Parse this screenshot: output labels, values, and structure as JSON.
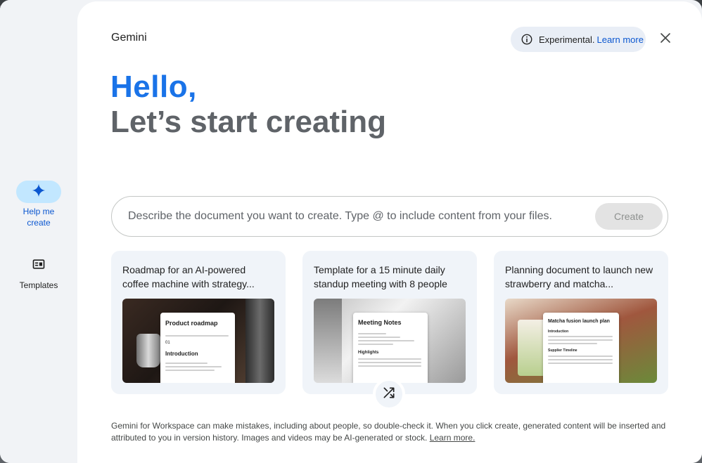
{
  "app": {
    "title": "Gemini"
  },
  "experimental": {
    "label": "Experimental.",
    "link": "Learn more"
  },
  "greeting": {
    "hello": "Hello,",
    "subtitle": "Let’s start creating"
  },
  "rail": {
    "items": [
      {
        "label": "Help me create",
        "icon": "sparkle-icon",
        "active": true
      },
      {
        "label": "Templates",
        "icon": "template-icon",
        "active": false
      }
    ]
  },
  "prompt": {
    "placeholder": "Describe the document you want to create. Type @ to include content from your files.",
    "value": "",
    "button": "Create"
  },
  "cards": [
    {
      "title": "Roadmap for an AI-powered coffee machine with strategy...",
      "doc_title": "Product roadmap",
      "doc_num": "01",
      "doc_heading": "Introduction"
    },
    {
      "title": "Template for a 15 minute daily standup meeting with 8 people",
      "doc_title": "Meeting Notes",
      "doc_heading": "Highlights"
    },
    {
      "title": "Planning document to launch new strawberry and matcha...",
      "doc_title": "Matcha fusion launch plan",
      "doc_heading": "Introduction",
      "doc_heading2": "Supplier Timeline"
    }
  ],
  "disclaimer": {
    "text": "Gemini for Workspace can make mistakes, including about people, so double-check it. When you click create, generated content will be inserted and attributed to you in version history. Images and videos may be AI-generated or stock.",
    "link": "Learn more."
  },
  "colors": {
    "accent": "#1a73e8",
    "rail_active": "#c2e7ff",
    "link": "#0b57d0"
  }
}
